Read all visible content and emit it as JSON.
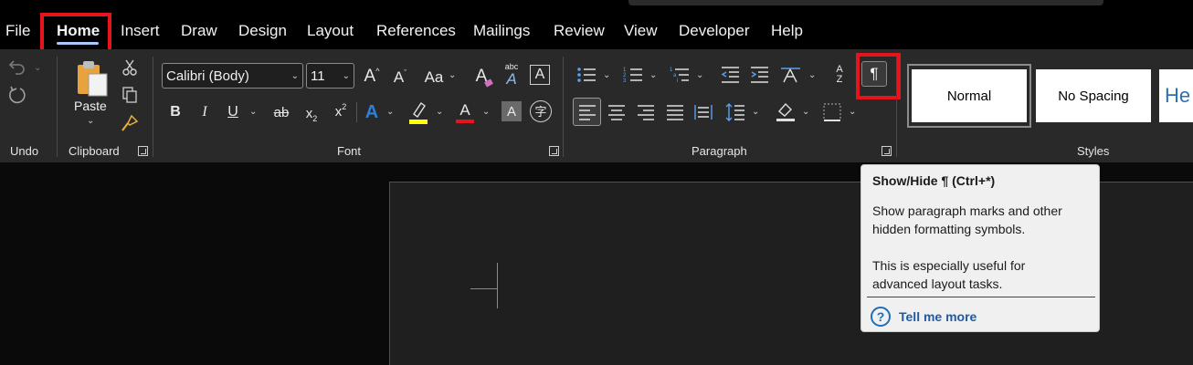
{
  "menu": {
    "tabs": [
      {
        "label": "File"
      },
      {
        "label": "Home",
        "active": true
      },
      {
        "label": "Insert"
      },
      {
        "label": "Draw"
      },
      {
        "label": "Design"
      },
      {
        "label": "Layout"
      },
      {
        "label": "References"
      },
      {
        "label": "Mailings"
      },
      {
        "label": "Review"
      },
      {
        "label": "View"
      },
      {
        "label": "Developer"
      },
      {
        "label": "Help"
      }
    ]
  },
  "ribbon": {
    "groups": {
      "undo": "Undo",
      "clipboard": "Clipboard",
      "font": "Font",
      "paragraph": "Paragraph",
      "styles": "Styles"
    },
    "clipboard": {
      "paste_label": "Paste"
    },
    "font": {
      "font_name": "Calibri (Body)",
      "font_size": "11",
      "grow_font_glyph": "A",
      "shrink_font_glyph": "A",
      "change_case_glyph": "Aa",
      "bold": "B",
      "italic": "I",
      "underline": "U",
      "strikethrough": "ab",
      "subscript": "x",
      "superscript": "x",
      "text_effects_glyph": "A",
      "font_color_glyph": "A",
      "char_shading_glyph": "A",
      "clear_formatting_glyph": "A",
      "phonetic_guide_label": "abc",
      "phonetic_guide_glyph": "A",
      "char_border_glyph": "A",
      "enclose_char_glyph": "字"
    },
    "paragraph": {
      "show_hide_glyph": "¶",
      "sort_az": "A",
      "sort_za": "Z"
    },
    "styles": [
      {
        "label": "Normal"
      },
      {
        "label": "No Spacing"
      },
      {
        "label": "He"
      }
    ]
  },
  "tooltip": {
    "title": "Show/Hide ¶ (Ctrl+*)",
    "line1": "Show paragraph marks and other",
    "line2": "hidden formatting symbols.",
    "line3": "This is especially useful for",
    "line4": "advanced layout tasks.",
    "help_glyph": "?",
    "link": "Tell me more"
  },
  "colors": {
    "highlight_box": "#e8141b",
    "highlight_yellow": "#ffff00",
    "font_color_red": "#e8141b",
    "link_blue": "#1f5aa6",
    "heading_blue": "#2f6eb5"
  }
}
